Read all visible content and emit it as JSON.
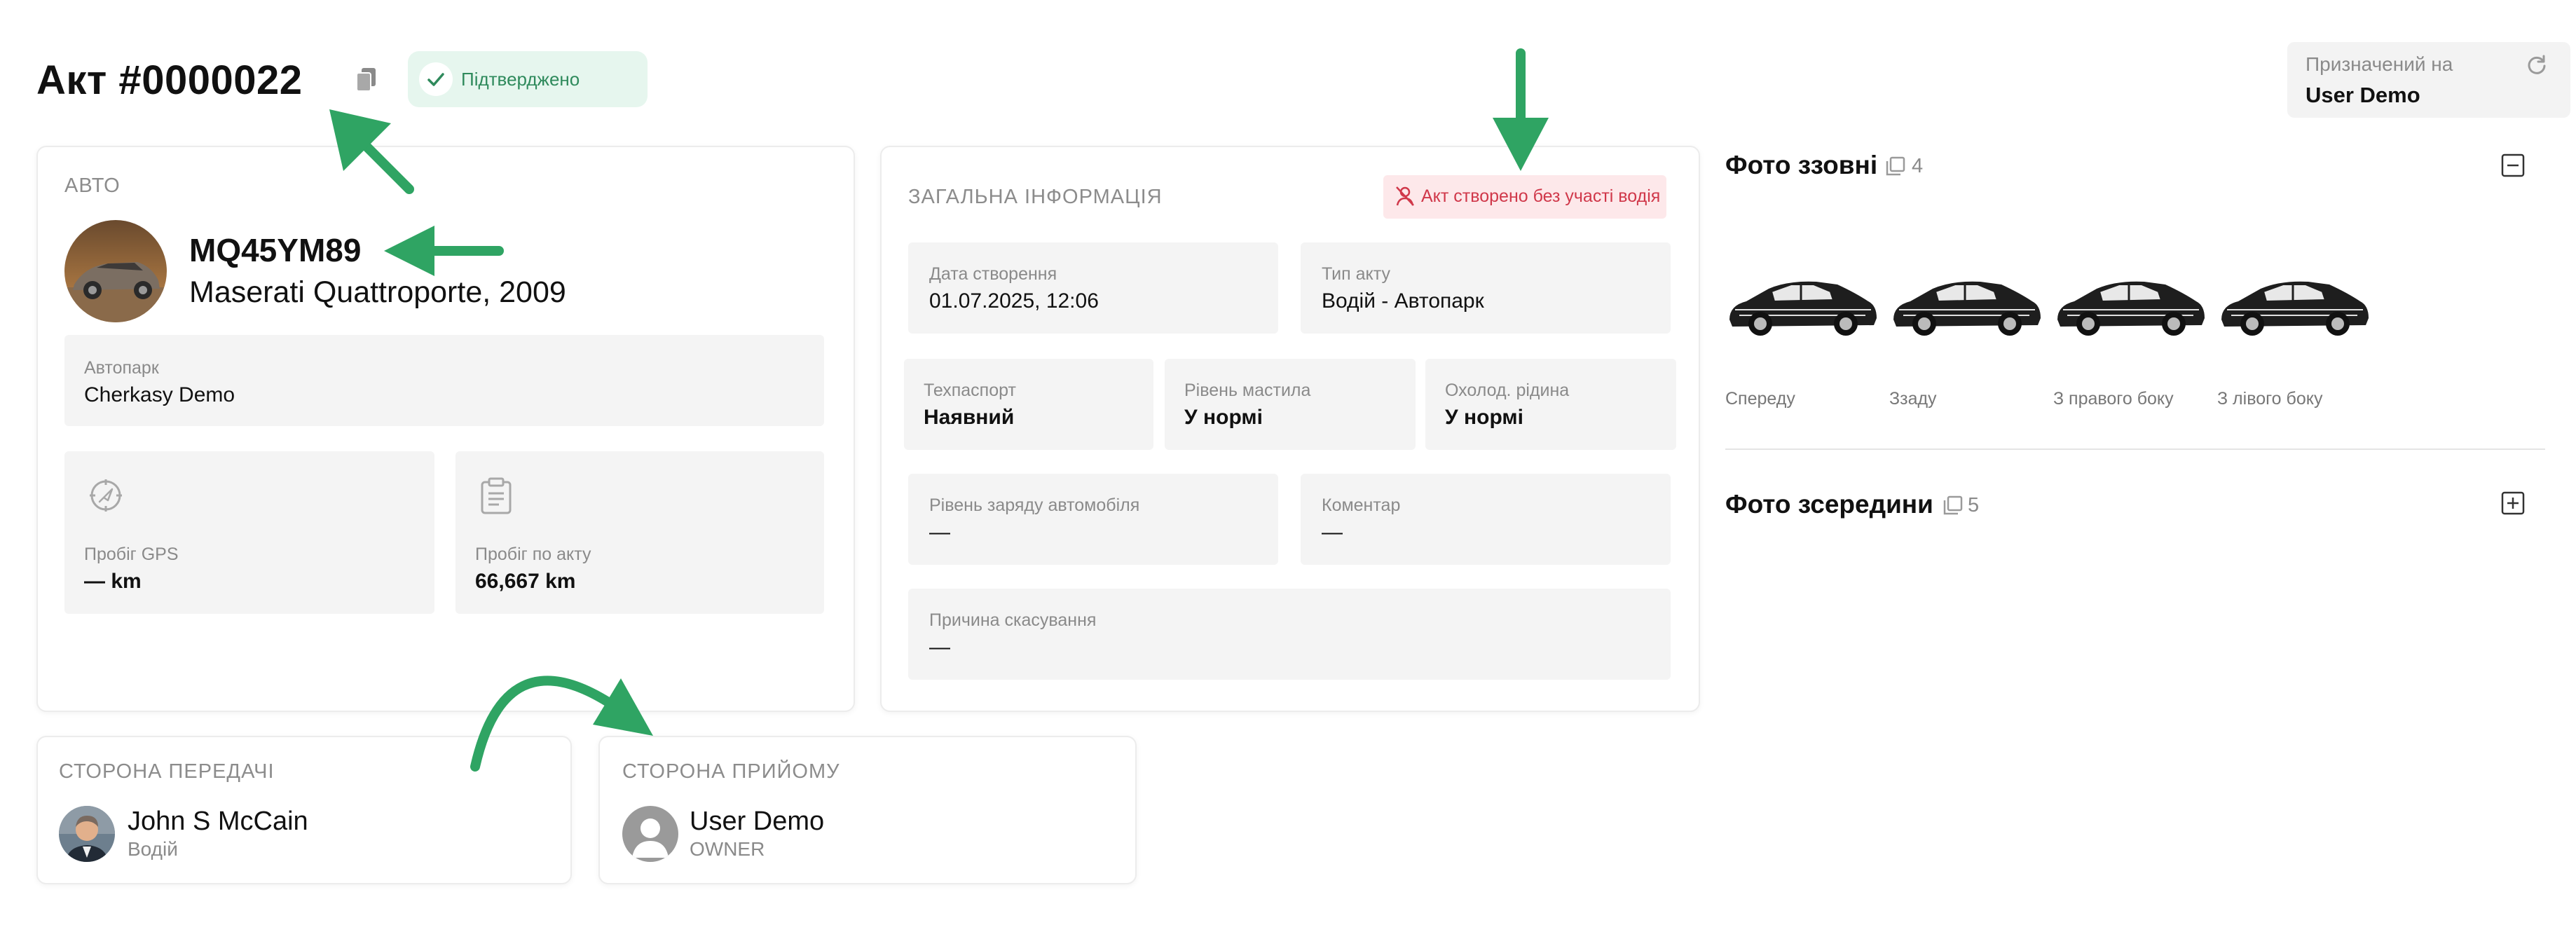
{
  "header": {
    "title": "Акт #0000022",
    "status": "Підтверджено",
    "assigned_label": "Призначений на",
    "assigned_value": "User Demo"
  },
  "auto": {
    "section_title": "АВТО",
    "plate": "MQ45YM89",
    "model": "Maserati Quattroporte, 2009",
    "fleet_label": "Автопарк",
    "fleet_value": "Cherkasy Demo",
    "gps_label": "Пробіг GPS",
    "gps_value": "— km",
    "act_label": "Пробіг по акту",
    "act_value": "66,667 km"
  },
  "general": {
    "section_title": "ЗАГАЛЬНА ІНФОРМАЦІЯ",
    "warning": "Акт створено без участі водія",
    "created_label": "Дата створення",
    "created_value": "01.07.2025, 12:06",
    "type_label": "Тип акту",
    "type_value": "Водій - Автопарк",
    "passport_label": "Техпаспорт",
    "passport_value": "Наявний",
    "oil_label": "Рівень мастила",
    "oil_value": "У нормі",
    "coolant_label": "Охолод. рідина",
    "coolant_value": "У нормі",
    "charge_label": "Рівень заряду автомобіля",
    "charge_value": "—",
    "comment_label": "Коментар",
    "comment_value": "—",
    "cancel_label": "Причина скасування",
    "cancel_value": "—"
  },
  "photos_outside": {
    "title": "Фото ззовні",
    "count": "4",
    "captions": [
      "Спереду",
      "Ззаду",
      "З правого боку",
      "З лівого боку"
    ]
  },
  "photos_inside": {
    "title": "Фото зсередини",
    "count": "5"
  },
  "transfer": {
    "section_title": "СТОРОНА ПЕРЕДАЧІ",
    "name": "John S McCain",
    "role": "Водій"
  },
  "receive": {
    "section_title": "СТОРОНА ПРИЙОМУ",
    "name": "User Demo",
    "role": "OWNER"
  },
  "colors": {
    "accent_green": "#2fa463",
    "status_bg": "#e6f6ee",
    "warning_bg": "#fde8ea",
    "warning_text": "#d0384a"
  },
  "icons": [
    "copy-icon",
    "check-icon",
    "refresh-icon",
    "gps-icon",
    "clipboard-icon",
    "driver-off-icon",
    "gallery-icon",
    "collapse-icon",
    "expand-icon",
    "user-icon"
  ]
}
